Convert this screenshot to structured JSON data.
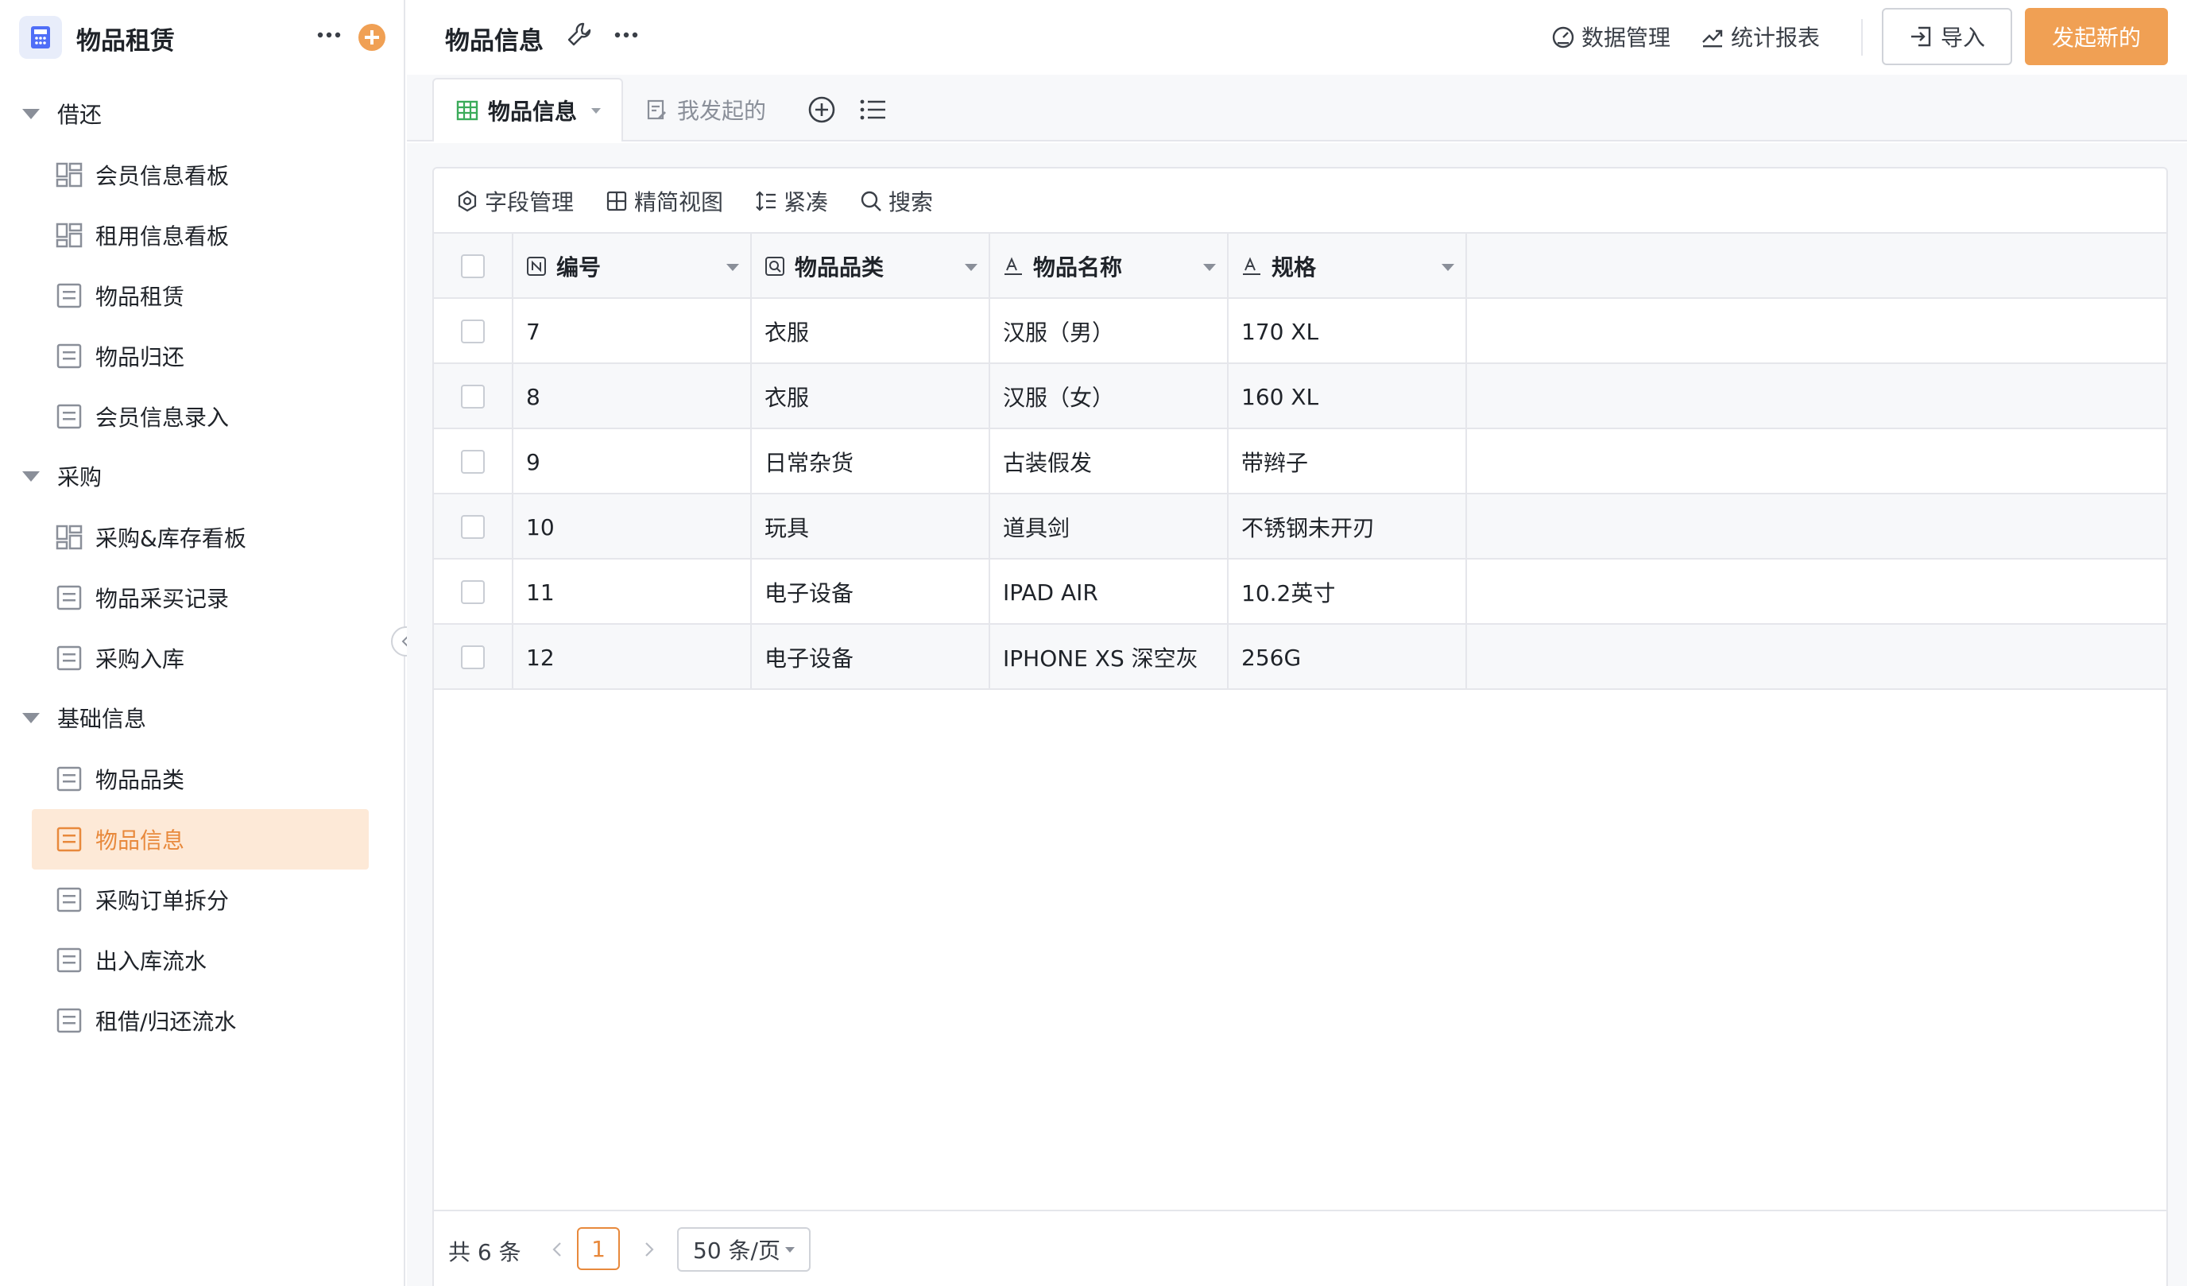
{
  "app": {
    "title": "物品租赁"
  },
  "sidebar": {
    "groups": [
      {
        "label": "借还",
        "items": [
          {
            "label": "会员信息看板",
            "icon": "dashboard-icon"
          },
          {
            "label": "租用信息看板",
            "icon": "dashboard-icon"
          },
          {
            "label": "物品租赁",
            "icon": "form-icon"
          },
          {
            "label": "物品归还",
            "icon": "form-icon"
          },
          {
            "label": "会员信息录入",
            "icon": "form-icon"
          }
        ]
      },
      {
        "label": "采购",
        "items": [
          {
            "label": "采购&库存看板",
            "icon": "dashboard-icon"
          },
          {
            "label": "物品采买记录",
            "icon": "form-icon"
          },
          {
            "label": "采购入库",
            "icon": "form-icon"
          }
        ]
      },
      {
        "label": "基础信息",
        "items": [
          {
            "label": "物品品类",
            "icon": "form-icon"
          },
          {
            "label": "物品信息",
            "icon": "form-icon",
            "active": true
          },
          {
            "label": "采购订单拆分",
            "icon": "form-icon"
          },
          {
            "label": "出入库流水",
            "icon": "form-icon"
          },
          {
            "label": "租借/归还流水",
            "icon": "form-icon"
          }
        ]
      }
    ]
  },
  "header": {
    "title": "物品信息",
    "data_mgmt": "数据管理",
    "stats_report": "统计报表",
    "import": "导入",
    "new": "发起新的"
  },
  "tabs": {
    "active": "物品信息",
    "mine": "我发起的"
  },
  "toolbar": {
    "fields": "字段管理",
    "simple_view": "精简视图",
    "compact": "紧凑",
    "search": "搜索"
  },
  "table": {
    "columns": [
      "编号",
      "物品品类",
      "物品名称",
      "规格"
    ],
    "rows": [
      [
        "7",
        "衣服",
        "汉服（男）",
        "170 XL"
      ],
      [
        "8",
        "衣服",
        "汉服（女）",
        "160 XL"
      ],
      [
        "9",
        "日常杂货",
        "古装假发",
        "带辫子"
      ],
      [
        "10",
        "玩具",
        "道具剑",
        "不锈钢未开刃"
      ],
      [
        "11",
        "电子设备",
        "IPAD AIR",
        "10.2英寸"
      ],
      [
        "12",
        "电子设备",
        "IPHONE XS 深空灰",
        "256G"
      ]
    ]
  },
  "pager": {
    "total": "共 6 条",
    "page": "1",
    "page_size": "50 条/页"
  },
  "colors": {
    "accent": "#f0a054",
    "accent_text": "#e8893c",
    "active_bg": "#fde9d7"
  }
}
